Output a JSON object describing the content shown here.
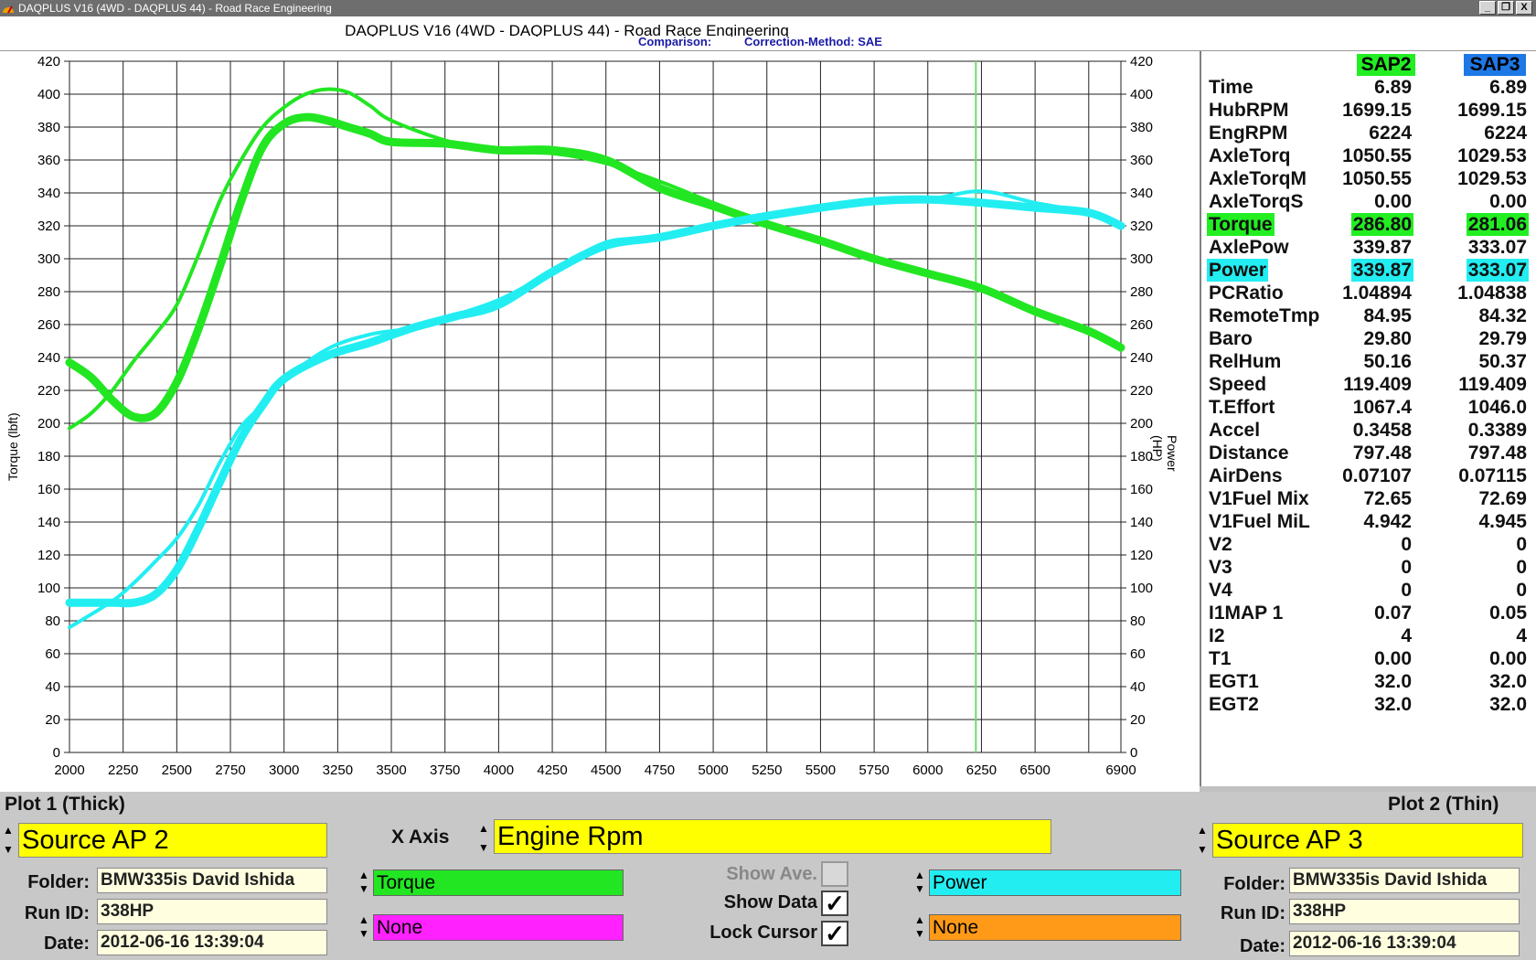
{
  "window": {
    "title": "DAQPLUS V16 (4WD - DAQPLUS 44) - Road Race Engineering",
    "buttons": [
      "_",
      "❐",
      "X"
    ]
  },
  "header": {
    "title": "DAQPLUS V16 (4WD - DAQPLUS 44) - Road Race Engineering",
    "comparison": "Comparison:",
    "correction": "Correction-Method: SAE"
  },
  "chart_data": {
    "type": "line",
    "xlabel": "",
    "ylabel_left": "Torque (lbft)",
    "ylabel_right": "Power (HP)",
    "xlim": [
      2000,
      6900
    ],
    "ylim": [
      0,
      420
    ],
    "x_ticks": [
      "2000",
      "2250",
      "2500",
      "2750",
      "3000",
      "3250",
      "3500",
      "3750",
      "4000",
      "4250",
      "4500",
      "4750",
      "5000",
      "5250",
      "5500",
      "5750",
      "6000",
      "6250",
      "6500",
      "6900"
    ],
    "y_ticks": [
      "0",
      "20",
      "40",
      "60",
      "80",
      "100",
      "120",
      "140",
      "160",
      "180",
      "200",
      "220",
      "240",
      "260",
      "280",
      "300",
      "320",
      "340",
      "360",
      "380",
      "400",
      "420"
    ],
    "cursor_rpm": 6224,
    "series": [
      {
        "name": "Torque",
        "color": "#22e622",
        "width": 9,
        "x": [
          2000,
          2100,
          2200,
          2300,
          2400,
          2500,
          2600,
          2700,
          2800,
          2900,
          3000,
          3100,
          3200,
          3300,
          3400,
          3500,
          3750,
          4000,
          4250,
          4500,
          4750,
          5000,
          5250,
          5500,
          5750,
          6000,
          6250,
          6500,
          6750,
          6900
        ],
        "y": [
          237,
          228,
          214,
          204,
          206,
          225,
          257,
          295,
          335,
          368,
          382,
          386,
          384,
          380,
          376,
          371,
          370,
          366,
          366,
          360,
          343,
          332,
          321,
          311,
          300,
          291,
          282,
          268,
          256,
          246
        ]
      },
      {
        "name": "Torque",
        "color": "#22e622",
        "width": 4,
        "x": [
          2000,
          2100,
          2200,
          2300,
          2400,
          2500,
          2600,
          2700,
          2800,
          2900,
          3000,
          3100,
          3200,
          3300,
          3400,
          3500,
          3750,
          4000,
          4250,
          4500,
          4750,
          5000,
          5250,
          5500,
          5750,
          6000,
          6250,
          6500,
          6750,
          6900
        ],
        "y": [
          197,
          206,
          220,
          238,
          254,
          272,
          302,
          335,
          360,
          380,
          392,
          400,
          403,
          401,
          393,
          384,
          372,
          365,
          364,
          358,
          347,
          334,
          322,
          312,
          301,
          292,
          283,
          268,
          256,
          245
        ]
      },
      {
        "name": "Power",
        "color": "#22eef2",
        "width": 9,
        "x": [
          2000,
          2200,
          2300,
          2400,
          2500,
          2600,
          2700,
          2800,
          2900,
          3000,
          3200,
          3400,
          3600,
          3800,
          4000,
          4250,
          4500,
          4750,
          5000,
          5250,
          5500,
          5750,
          6000,
          6250,
          6500,
          6750,
          6900
        ],
        "y": [
          91,
          91,
          91,
          96,
          111,
          136,
          164,
          191,
          211,
          227,
          241,
          249,
          258,
          265,
          272,
          292,
          308,
          313,
          320,
          326,
          331,
          335,
          336,
          334,
          331,
          328,
          320
        ]
      },
      {
        "name": "Power",
        "color": "#22eef2",
        "width": 4,
        "x": [
          2000,
          2200,
          2300,
          2400,
          2500,
          2600,
          2700,
          2800,
          2900,
          3000,
          3200,
          3400,
          3600,
          3800,
          4000,
          4250,
          4500,
          4750,
          5000,
          5250,
          5500,
          5750,
          6000,
          6250,
          6500,
          6750,
          6900
        ],
        "y": [
          76,
          92,
          103,
          116,
          130,
          150,
          176,
          198,
          211,
          226,
          245,
          254,
          258,
          266,
          275,
          292,
          310,
          313,
          321,
          326,
          331,
          334,
          336,
          341,
          334,
          328,
          321
        ]
      }
    ]
  },
  "data_panel": {
    "col1_header": "SAP2",
    "col2_header": "SAP3",
    "rows": [
      {
        "label": "Time",
        "v1": "6.89",
        "v2": "6.89",
        "hl": ""
      },
      {
        "label": "HubRPM",
        "v1": "1699.15",
        "v2": "1699.15",
        "hl": ""
      },
      {
        "label": "EngRPM",
        "v1": "6224",
        "v2": "6224",
        "hl": ""
      },
      {
        "label": "AxleTorq",
        "v1": "1050.55",
        "v2": "1029.53",
        "hl": ""
      },
      {
        "label": "AxleTorqM",
        "v1": "1050.55",
        "v2": "1029.53",
        "hl": ""
      },
      {
        "label": "AxleTorqS",
        "v1": "0.00",
        "v2": "0.00",
        "hl": ""
      },
      {
        "label": "Torque",
        "v1": "286.80",
        "v2": "281.06",
        "hl": "green"
      },
      {
        "label": "AxlePow",
        "v1": "339.87",
        "v2": "333.07",
        "hl": ""
      },
      {
        "label": "Power",
        "v1": "339.87",
        "v2": "333.07",
        "hl": "cyan"
      },
      {
        "label": "PCRatio",
        "v1": "1.04894",
        "v2": "1.04838",
        "hl": ""
      },
      {
        "label": "RemoteTmp",
        "v1": "84.95",
        "v2": "84.32",
        "hl": ""
      },
      {
        "label": "Baro",
        "v1": "29.80",
        "v2": "29.79",
        "hl": ""
      },
      {
        "label": "RelHum",
        "v1": "50.16",
        "v2": "50.37",
        "hl": ""
      },
      {
        "label": "Speed",
        "v1": "119.409",
        "v2": "119.409",
        "hl": ""
      },
      {
        "label": "T.Effort",
        "v1": "1067.4",
        "v2": "1046.0",
        "hl": ""
      },
      {
        "label": "Accel",
        "v1": "0.3458",
        "v2": "0.3389",
        "hl": ""
      },
      {
        "label": "Distance",
        "v1": "797.48",
        "v2": "797.48",
        "hl": ""
      },
      {
        "label": "AirDens",
        "v1": "0.07107",
        "v2": "0.07115",
        "hl": ""
      },
      {
        "label": "V1Fuel Mix",
        "v1": "72.65",
        "v2": "72.69",
        "hl": ""
      },
      {
        "label": "V1Fuel MiL",
        "v1": "4.942",
        "v2": "4.945",
        "hl": ""
      },
      {
        "label": "V2",
        "v1": "0",
        "v2": "0",
        "hl": ""
      },
      {
        "label": "V3",
        "v1": "0",
        "v2": "0",
        "hl": ""
      },
      {
        "label": "V4",
        "v1": "0",
        "v2": "0",
        "hl": ""
      },
      {
        "label": "I1MAP 1",
        "v1": "0.07",
        "v2": "0.05",
        "hl": ""
      },
      {
        "label": "I2",
        "v1": "4",
        "v2": "4",
        "hl": ""
      },
      {
        "label": "T1",
        "v1": "0.00",
        "v2": "0.00",
        "hl": ""
      },
      {
        "label": "EGT1",
        "v1": "32.0",
        "v2": "32.0",
        "hl": ""
      },
      {
        "label": "EGT2",
        "v1": "32.0",
        "v2": "32.0",
        "hl": ""
      }
    ]
  },
  "bottom": {
    "plot1_label": "Plot 1 (Thick)",
    "plot2_label": "Plot 2 (Thin)",
    "source1": "Source AP 2",
    "source2": "Source AP 3",
    "x_axis_label": "X Axis",
    "x_axis_value": "Engine Rpm",
    "folder_label": "Folder:",
    "runid_label": "Run ID:",
    "date_label": "Date:",
    "folder1": "BMW335is David Ishida",
    "runid1": "338HP",
    "date1": "2012-06-16 13:39:04",
    "folder2": "BMW335is David Ishida",
    "runid2": "338HP",
    "date2": "2012-06-16 13:39:04",
    "ch1": "Torque",
    "ch2": "None",
    "ch3": "Power",
    "ch4": "None",
    "show_ave": "Show Ave.",
    "show_data": "Show Data",
    "lock_cursor": "Lock Cursor",
    "check_mark": "✓",
    "spin_up": "▲",
    "spin_down": "▼"
  }
}
